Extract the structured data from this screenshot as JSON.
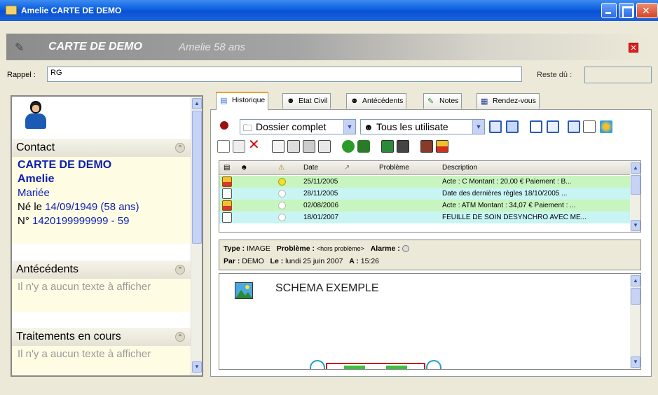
{
  "window": {
    "title": "Amelie CARTE DE DEMO"
  },
  "header": {
    "name": "CARTE DE DEMO",
    "subtitle": "Amelie 58 ans"
  },
  "rappel": {
    "label": "Rappel :",
    "value": "RG"
  },
  "reste": {
    "label": "Reste dû :",
    "value": ""
  },
  "left": {
    "contact_title": "Contact",
    "contact": {
      "lastname": "CARTE DE DEMO",
      "firstname": "Amelie",
      "status": "Mariée",
      "born_prefix": "Né le ",
      "born_date": "14/09/1949 (58 ans)",
      "num_prefix": "N° ",
      "num": "1420199999999 - 59"
    },
    "antecedents_title": "Antécédents",
    "antecedents_text": "Il n'y a aucun texte à afficher",
    "traitements_title": "Traitements en cours",
    "traitements_text": "Il n'y a aucun texte à afficher"
  },
  "tabs": [
    {
      "label": "Historique"
    },
    {
      "label": "Etat Civil"
    },
    {
      "label": "Antécédents"
    },
    {
      "label": "Notes"
    },
    {
      "label": "Rendez-vous"
    }
  ],
  "toolbar": {
    "dossier_combo": "Dossier complet",
    "users_combo": "Tous les utilisate"
  },
  "table": {
    "columns": [
      "Date",
      "Problème",
      "Description"
    ],
    "rows": [
      {
        "date": "25/11/2005",
        "probleme": "",
        "description": "Acte : C  Montant : 20,00 €  Paiement : B...",
        "color": "#c8f4c0",
        "dot": "#f0e030",
        "icon": "folder"
      },
      {
        "date": "28/11/2005",
        "probleme": "",
        "description": "Date des dernières règles  18/10/2005   ...",
        "color": "#c8f4f4",
        "dot": "#ffffff",
        "icon": "doc"
      },
      {
        "date": "02/08/2006",
        "probleme": "",
        "description": "Acte : ATM  Montant : 34,07 €  Paiement : ...",
        "color": "#c8f4c0",
        "dot": "#ffffff",
        "icon": "folder"
      },
      {
        "date": "18/01/2007",
        "probleme": "",
        "description": "FEUILLE DE SOIN DESYNCHRO AVEC ME...",
        "color": "#c8f4f4",
        "dot": "#ffffff",
        "icon": "doc"
      }
    ]
  },
  "detail": {
    "type_label": "Type :",
    "type_value": "IMAGE",
    "probleme_label": "Problème :",
    "probleme_value": "<hors problème>",
    "alarme_label": "Alarme :",
    "par_label": "Par :",
    "par_value": "DEMO",
    "le_label": "Le :",
    "le_value": "lundi 25 juin 2007",
    "a_label": "A :",
    "a_value": "15:26"
  },
  "preview": {
    "title": "SCHEMA EXEMPLE"
  }
}
